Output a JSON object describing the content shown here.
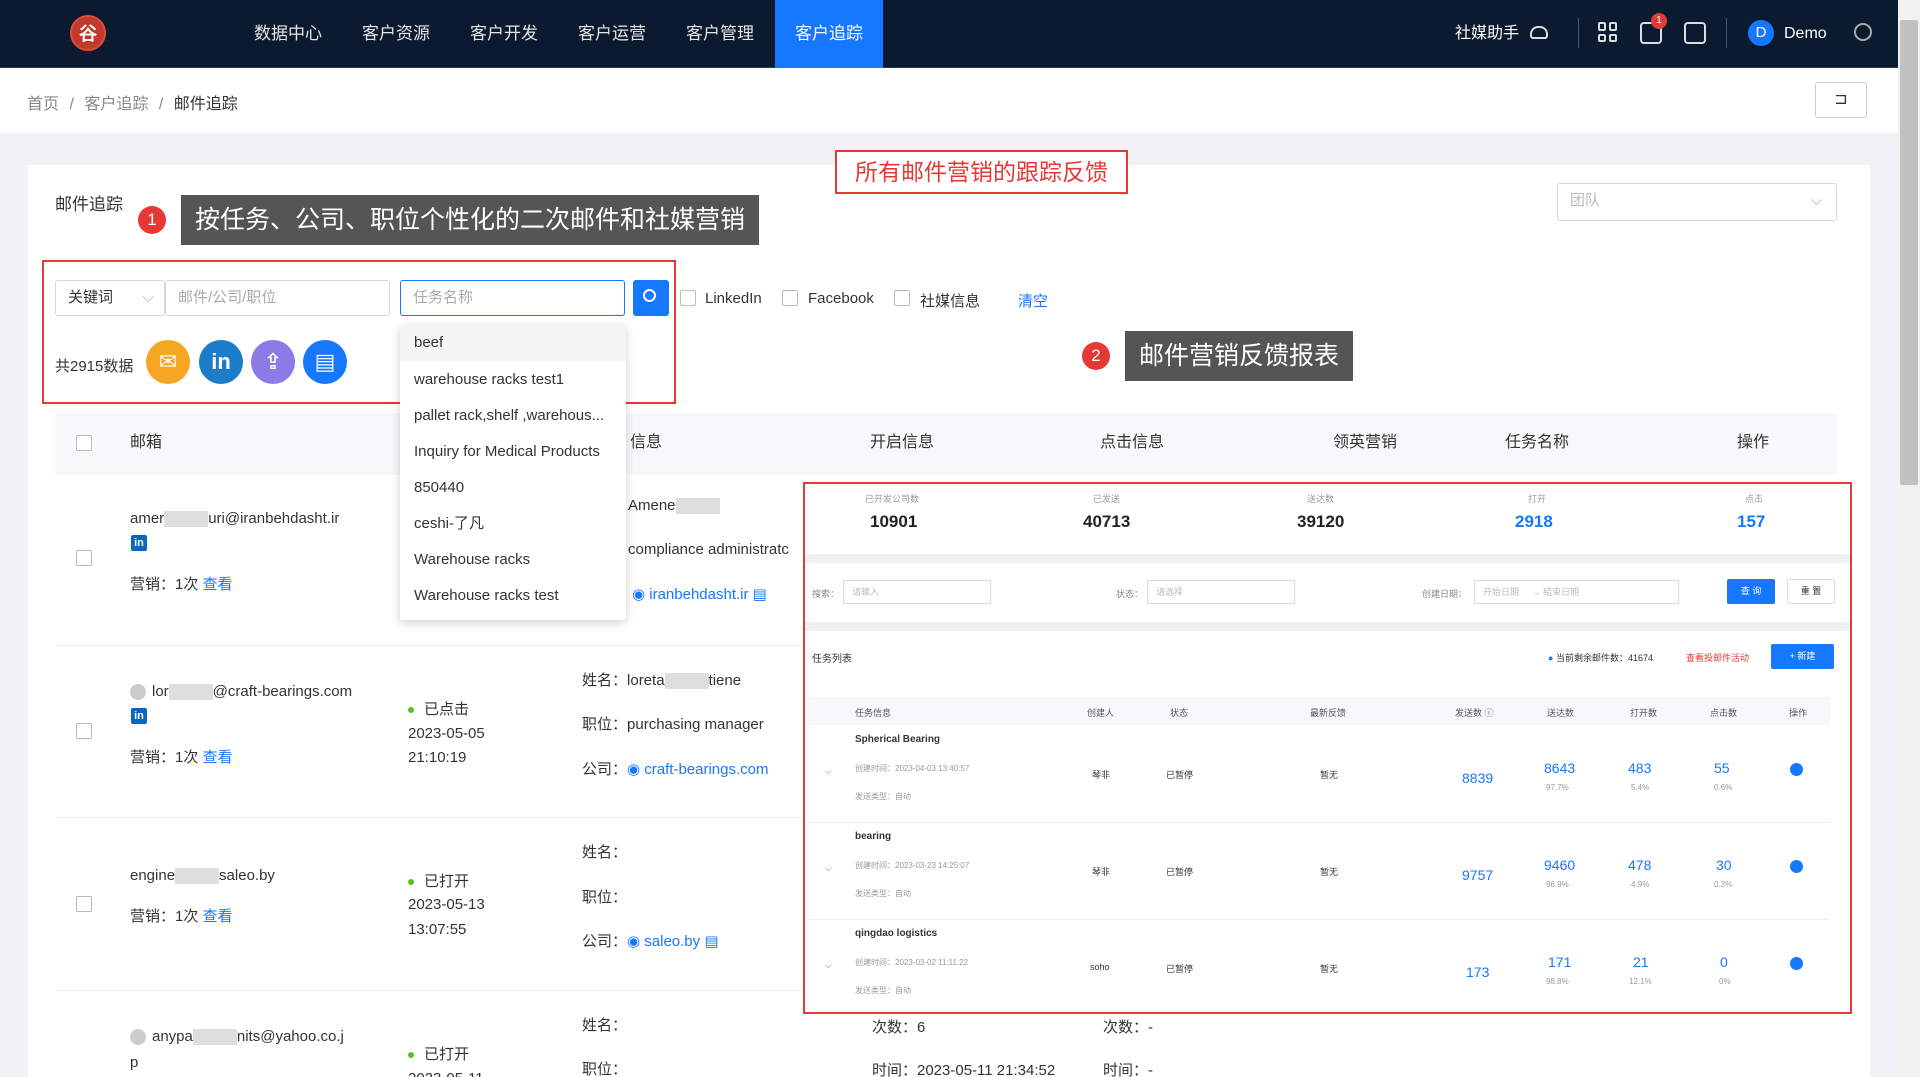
{
  "nav": {
    "logo": "谷",
    "items": [
      "数据中心",
      "客户资源",
      "客户开发",
      "客户运营",
      "客户管理",
      "客户追踪"
    ],
    "right_label": "社媒助手",
    "badge": "1",
    "avatar": "D",
    "user": "Demo"
  },
  "breadcrumb": {
    "home": "首页",
    "sep": "/",
    "parent": "客户追踪",
    "current": "邮件追踪"
  },
  "fullscreen_icon": "⊐",
  "page": {
    "title": "邮件追踪",
    "team_placeholder": "团队"
  },
  "annotations": {
    "top": "所有邮件营销的跟踪反馈",
    "n1": "1",
    "c1": "按任务、公司、职位个性化的二次邮件和社媒营销",
    "n2": "2",
    "c2": "邮件营销反馈报表"
  },
  "filters": {
    "keyword": "关键词",
    "keyword_placeholder": "邮件/公司/职位",
    "task_placeholder": "任务名称",
    "linkedin": "LinkedIn",
    "facebook": "Facebook",
    "social": "社媒信息",
    "clear": "清空",
    "total": "共2915数据"
  },
  "dropdown": [
    "beef",
    "warehouse racks test1",
    "pallet rack,shelf ,warehous...",
    "Inquiry for Medical Products",
    "850440",
    "ceshi-了凡",
    "Warehouse racks",
    "Warehouse racks test"
  ],
  "table": {
    "headers": [
      "邮箱",
      "信息",
      "开启信息",
      "点击信息",
      "领英营销",
      "任务名称",
      "操作"
    ]
  },
  "rows": [
    {
      "email_a": "amer",
      "email_b": "uri@iranbehdasht.ir",
      "market": "营销：1次",
      "view": "查看",
      "name": "Amene",
      "position": "compliance administratc",
      "company": "iranbehdasht.ir"
    },
    {
      "email_a": "lor",
      "email_b": "@craft-bearings.com",
      "market": "营销：1次",
      "view": "查看",
      "status": "已点击",
      "date": "2023-05-05",
      "time": "21:10:19",
      "name_label": "姓名：",
      "name_a": "loreta",
      "name_b": "tiene",
      "pos_label": "职位：",
      "position": "purchasing manager",
      "comp_label": "公司：",
      "company": "craft-bearings.com"
    },
    {
      "email_a": "engine",
      "email_b": "saleo.by",
      "market": "营销：1次",
      "view": "查看",
      "status": "已打开",
      "date": "2023-05-13",
      "time": "13:07:55",
      "name_label": "姓名：",
      "pos_label": "职位：",
      "comp_label": "公司：",
      "company": "saleo.by"
    },
    {
      "email_a": "anypa",
      "email_b": "nits@yahoo.co.j",
      "email_c": "p",
      "status": "已打开",
      "date": "2023-05-11",
      "name_label": "姓名：",
      "pos_label": "职位：",
      "count": "次数：6",
      "count2": "次数：-",
      "time_open": "时间：2023-05-11 21:34:52",
      "time2": "时间：-"
    }
  ],
  "report": {
    "stats": [
      {
        "label": "已开发公司数",
        "value": "10901"
      },
      {
        "label": "已发送",
        "value": "40713"
      },
      {
        "label": "送达数",
        "value": "39120"
      },
      {
        "label": "打开",
        "value": "2918"
      },
      {
        "label": "点击",
        "value": "157"
      }
    ],
    "search_label": "搜索：",
    "search_ph": "请输入",
    "status_label": "状态：",
    "status_ph": "请选择",
    "date_label": "创建日期：",
    "start_ph": "开始日期",
    "arrow": "→",
    "end_ph": "结束日期",
    "query": "查 询",
    "reset": "重 置",
    "list_title": "任务列表",
    "remain": "当前剩余邮件数：41674",
    "view_activity": "查看投邮件活动",
    "new": "+ 新建",
    "headers": [
      "任务信息",
      "创建人",
      "状态",
      "最新反馈",
      "发送数 ⓘ",
      "送达数",
      "打开数",
      "点击数",
      "操作"
    ],
    "tasks": [
      {
        "name": "Spherical Bearing",
        "created": "创建时间：2023-04-03 13:40:57",
        "type": "发送类型：自动",
        "creator": "琴非",
        "status": "已暂停",
        "feedback": "暂无",
        "sent": "8839",
        "delivered": "8643",
        "dp": "97.7%",
        "opened": "483",
        "op": "5.4%",
        "clicked": "55",
        "cp": "0.6%"
      },
      {
        "name": "bearing",
        "created": "创建时间：2023-03-23 14:25:07",
        "type": "发送类型：自动",
        "creator": "琴非",
        "status": "已暂停",
        "feedback": "暂无",
        "sent": "9757",
        "delivered": "9460",
        "dp": "96.9%",
        "opened": "478",
        "op": "4.9%",
        "clicked": "30",
        "cp": "0.3%"
      },
      {
        "name": "qingdao logistics",
        "created": "创建时间：2023-03-02 11:11:22",
        "type": "发送类型：自动",
        "creator": "soho",
        "status": "已暂停",
        "feedback": "暂无",
        "sent": "173",
        "delivered": "171",
        "dp": "98.8%",
        "opened": "21",
        "op": "12.1%",
        "clicked": "0",
        "cp": "0%"
      }
    ]
  }
}
